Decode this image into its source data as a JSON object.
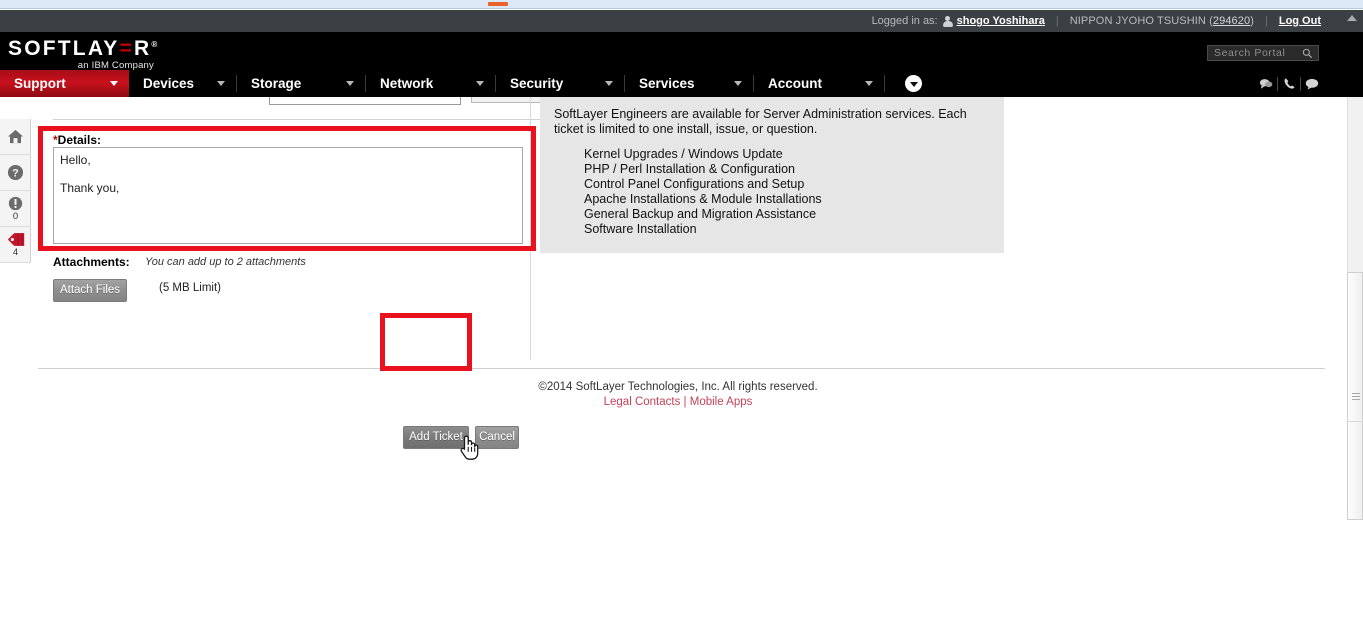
{
  "browser": {
    "tab_mark": ""
  },
  "utility_bar": {
    "logged_in_label": "Logged in as:",
    "user_name": "shogo Yoshihara",
    "account_name": "NIPPON JYOHO TSUSHIN",
    "account_id": "294620",
    "logout_label": "Log Out",
    "person_icon": "person-icon",
    "bg_color": "#3c3f44"
  },
  "header": {
    "logo_text": "SOFTLAY",
    "logo_eq": "=",
    "logo_text_end": "R",
    "logo_tm": "®",
    "logo_subtitle": "an IBM Company",
    "brand_red": "#c8111d"
  },
  "search": {
    "placeholder": "Search Portal",
    "value": "",
    "icon": "search-icon"
  },
  "nav": {
    "items": [
      {
        "label": "Support",
        "active": true,
        "caret": "chevron-down-icon"
      },
      {
        "label": "Devices",
        "active": false,
        "caret": "chevron-down-icon"
      },
      {
        "label": "Storage",
        "active": false,
        "caret": "chevron-down-icon"
      },
      {
        "label": "Network",
        "active": false,
        "caret": "chevron-down-icon"
      },
      {
        "label": "Security",
        "active": false,
        "caret": "chevron-down-icon"
      },
      {
        "label": "Services",
        "active": false,
        "caret": "chevron-down-icon"
      },
      {
        "label": "Account",
        "active": false,
        "caret": "chevron-down-icon"
      }
    ],
    "more_button_icon": "chevron-down-circle-icon",
    "right_icons": [
      "chat-bubble-icon",
      "phone-icon",
      "comment-icon"
    ]
  },
  "rail": {
    "items": [
      {
        "icon": "home-icon",
        "count": ""
      },
      {
        "icon": "help-icon",
        "count": ""
      },
      {
        "icon": "alert-icon",
        "count": "0"
      },
      {
        "icon": "tag-icon",
        "count": "4"
      }
    ]
  },
  "form": {
    "details_label": "Details:",
    "details_required_mark": "*",
    "details_value": "Hello,\n\nThank you,",
    "attachments_label": "Attachments:",
    "attachments_note": "You can add up to 2 attachments",
    "attach_button_label": "Attach Files",
    "attach_limit_text": "(5 MB Limit)",
    "submit_label": "Add Ticket",
    "cancel_label": "Cancel"
  },
  "info_panel": {
    "paragraph": "SoftLayer Engineers are available for Server Administration services. Each ticket is limited to one install, issue, or question.",
    "items": [
      "Kernel Upgrades / Windows Update",
      "PHP / Perl Installation & Configuration",
      "Control Panel Configurations and Setup",
      "Apache Installations & Module Installations",
      "General Backup and Migration Assistance",
      "Software Installation"
    ],
    "bg_color": "#e6e6e6"
  },
  "footer": {
    "copyright": "©2014 SoftLayer Technologies, Inc. All rights reserved.",
    "legal_link": "Legal Contacts",
    "separator": "|",
    "mobile_link": "Mobile Apps",
    "link_color": "#c4425a"
  },
  "annotations": {
    "color": "#e8111d",
    "details_box": "highlight-details-field",
    "button_box": "highlight-add-ticket-button"
  },
  "cursor": {
    "type": "pointing-hand"
  }
}
